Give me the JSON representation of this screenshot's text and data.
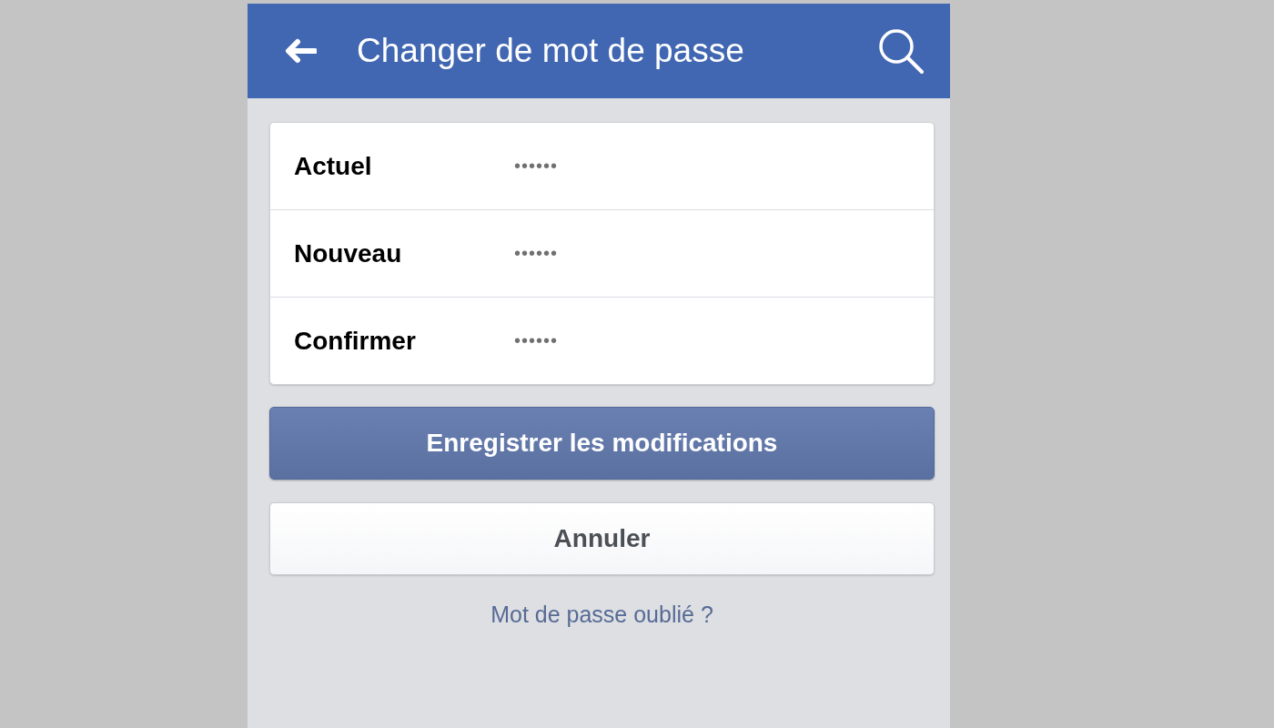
{
  "header": {
    "title": "Changer de mot de passe"
  },
  "fields": [
    {
      "label": "Actuel",
      "value": "••••••"
    },
    {
      "label": "Nouveau",
      "value": "••••••"
    },
    {
      "label": "Confirmer",
      "value": "••••••"
    }
  ],
  "buttons": [
    {
      "label": "Enregistrer les modifications",
      "kind": "primary"
    },
    {
      "label": "Annuler",
      "kind": "secondary"
    }
  ],
  "link": "Mot de passe oublié ?"
}
